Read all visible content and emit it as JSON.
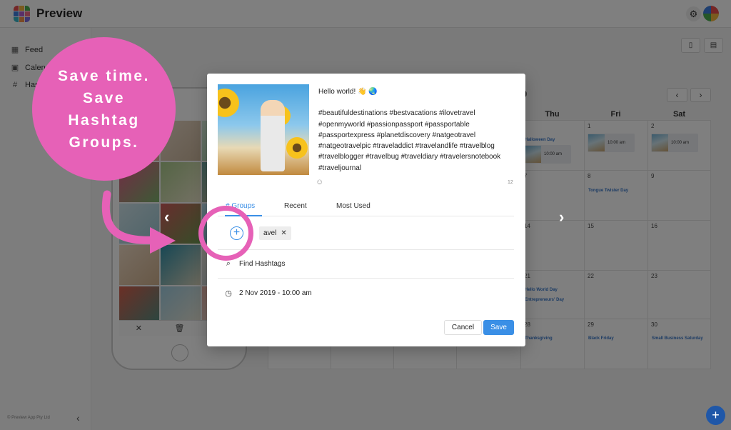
{
  "app": {
    "title": "Preview",
    "logo_colors": [
      "#e84d4d",
      "#f4b63f",
      "#4caf50",
      "#3f7fe0",
      "#b55fd1",
      "#f26c8a",
      "#39b6c8",
      "#f7934a",
      "#7a6de0"
    ]
  },
  "header": {
    "settings_icon": "gear-icon",
    "avatar_icon": "user-avatar"
  },
  "sidebar": {
    "items": [
      {
        "label": "Feed",
        "icon": "grid-icon"
      },
      {
        "label": "Calend",
        "icon": "calendar-icon"
      },
      {
        "label": "Has",
        "icon": "hash-icon"
      }
    ],
    "footer": "© Preview App Pty Ltd"
  },
  "calendar": {
    "month_fragment": "9",
    "weekdays": [
      "Thu",
      "Fri",
      "Sat"
    ],
    "cells": [
      {
        "day": "",
        "holiday": "Halloween Day",
        "event_time": "10:00 am"
      },
      {
        "day": "1",
        "holiday": "",
        "event_time": "10:00 am"
      },
      {
        "day": "2",
        "holiday": "",
        "event_time": "10:00 am"
      },
      {
        "day": "7",
        "holiday": "",
        "event_time": ""
      },
      {
        "day": "8",
        "holiday": "Tongue Twister Day",
        "event_time": ""
      },
      {
        "day": "9",
        "holiday": "",
        "event_time": ""
      },
      {
        "day": "14",
        "holiday": "",
        "event_time": ""
      },
      {
        "day": "15",
        "holiday": "",
        "event_time": ""
      },
      {
        "day": "16",
        "holiday": "",
        "event_time": ""
      },
      {
        "day": "21",
        "holiday": "Hello World Day",
        "holiday2": "Entrepreneurs' Day",
        "event_time": ""
      },
      {
        "day": "22",
        "holiday": "",
        "event_time": ""
      },
      {
        "day": "23",
        "holiday": "",
        "event_time": ""
      },
      {
        "day": "28",
        "holiday": "Thanksgiving",
        "event_time": ""
      },
      {
        "day": "29",
        "holiday": "Black Friday",
        "event_time": ""
      },
      {
        "day": "30",
        "holiday": "Small Business Saturday",
        "event_time": ""
      }
    ]
  },
  "modal": {
    "caption_greeting": "Hello world! 👋 🌏",
    "caption_hashtags": "#beautifuldestinations #bestvacations #ilovetravel #openmyworld #passionpassport #passportable #passportexpress #planetdiscovery #natgeotravel #natgeotravelpic #traveladdict #travelandlife #travelblog #travelblogger #travelbug #traveldiary #travelersnotebook #traveljournal",
    "char_count": "12",
    "tabs": [
      "# Groups",
      "Recent",
      "Most Used"
    ],
    "group_chip": "avel",
    "find_label": "Find Hashtags",
    "schedule": "2 Nov 2019 - 10:00 am",
    "cancel_label": "Cancel",
    "save_label": "Save"
  },
  "promo": {
    "line1": "Save time.",
    "line2": "Save",
    "line3": "Hashtag",
    "line4": "Groups.",
    "color": "#e661b7"
  }
}
